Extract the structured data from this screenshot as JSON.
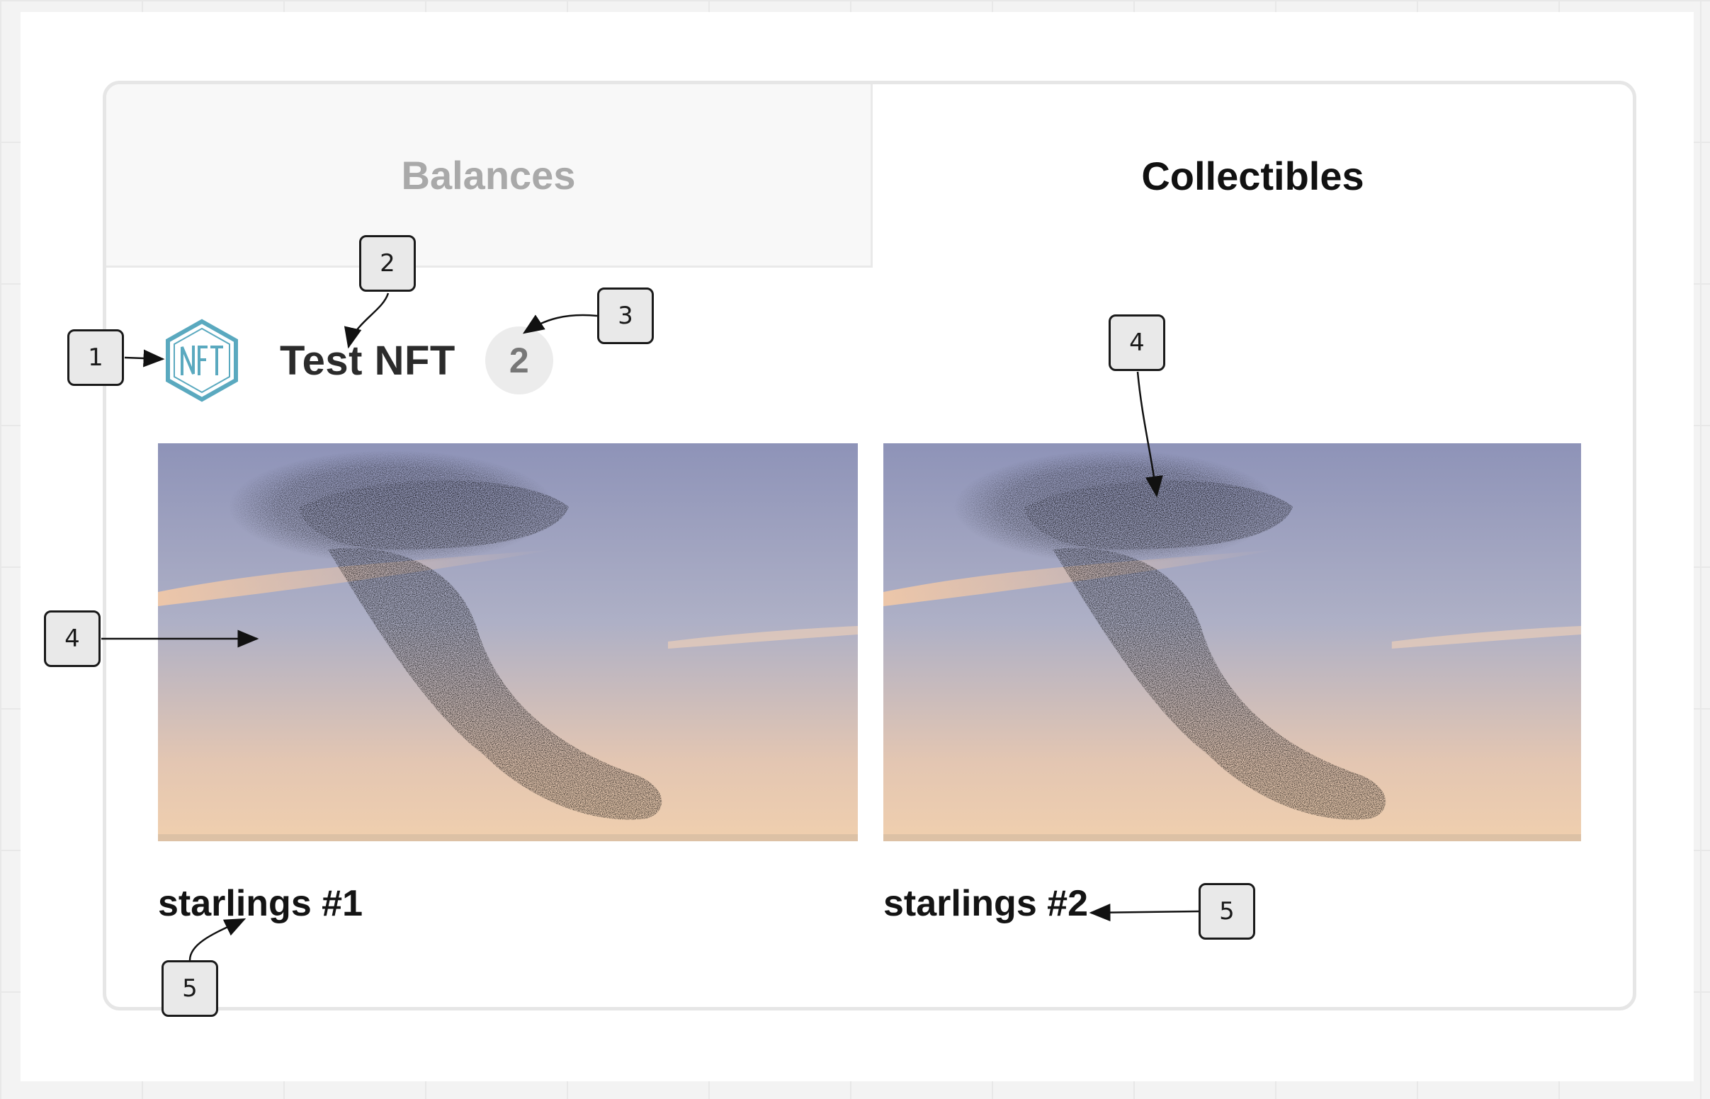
{
  "tabs": [
    {
      "label": "Balances",
      "active": false
    },
    {
      "label": "Collectibles",
      "active": true
    }
  ],
  "collection": {
    "logo_text": "NFT",
    "name": "Test NFT",
    "count": "2"
  },
  "items": [
    {
      "title": "starlings #1",
      "image": "starling-murmuration-photo"
    },
    {
      "title": "starlings #2",
      "image": "starling-murmuration-photo"
    }
  ],
  "callouts": [
    "1",
    "2",
    "3",
    "4",
    "4",
    "5",
    "5"
  ],
  "colors": {
    "logo": "#5aa9bf",
    "active_tab_text": "#111111",
    "inactive_tab_text": "#a9a9a9",
    "badge_bg": "#ececec"
  }
}
